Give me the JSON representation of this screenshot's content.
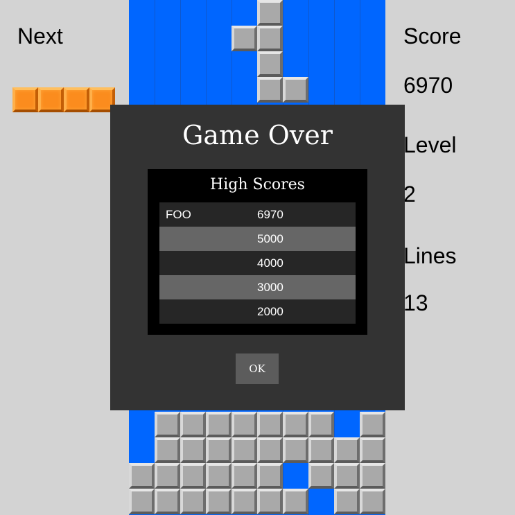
{
  "sidebar": {
    "next_label": "Next",
    "score_label": "Score",
    "score_value": "6970",
    "level_label": "Level",
    "level_value": "2",
    "lines_label": "Lines",
    "lines_value": "13"
  },
  "next_piece": {
    "shape": "I",
    "color": "#fb8c1e",
    "blocks": 4
  },
  "board": {
    "columns": 10,
    "background": "#0066ff",
    "block_color": "#a9a9a9"
  },
  "game_over": {
    "title": "Game Over",
    "high_scores_title": "High Scores",
    "scores": [
      {
        "name": "FOO",
        "score": "6970"
      },
      {
        "name": "",
        "score": "5000"
      },
      {
        "name": "",
        "score": "4000"
      },
      {
        "name": "",
        "score": "3000"
      },
      {
        "name": "",
        "score": "2000"
      }
    ],
    "ok_label": "OK"
  }
}
